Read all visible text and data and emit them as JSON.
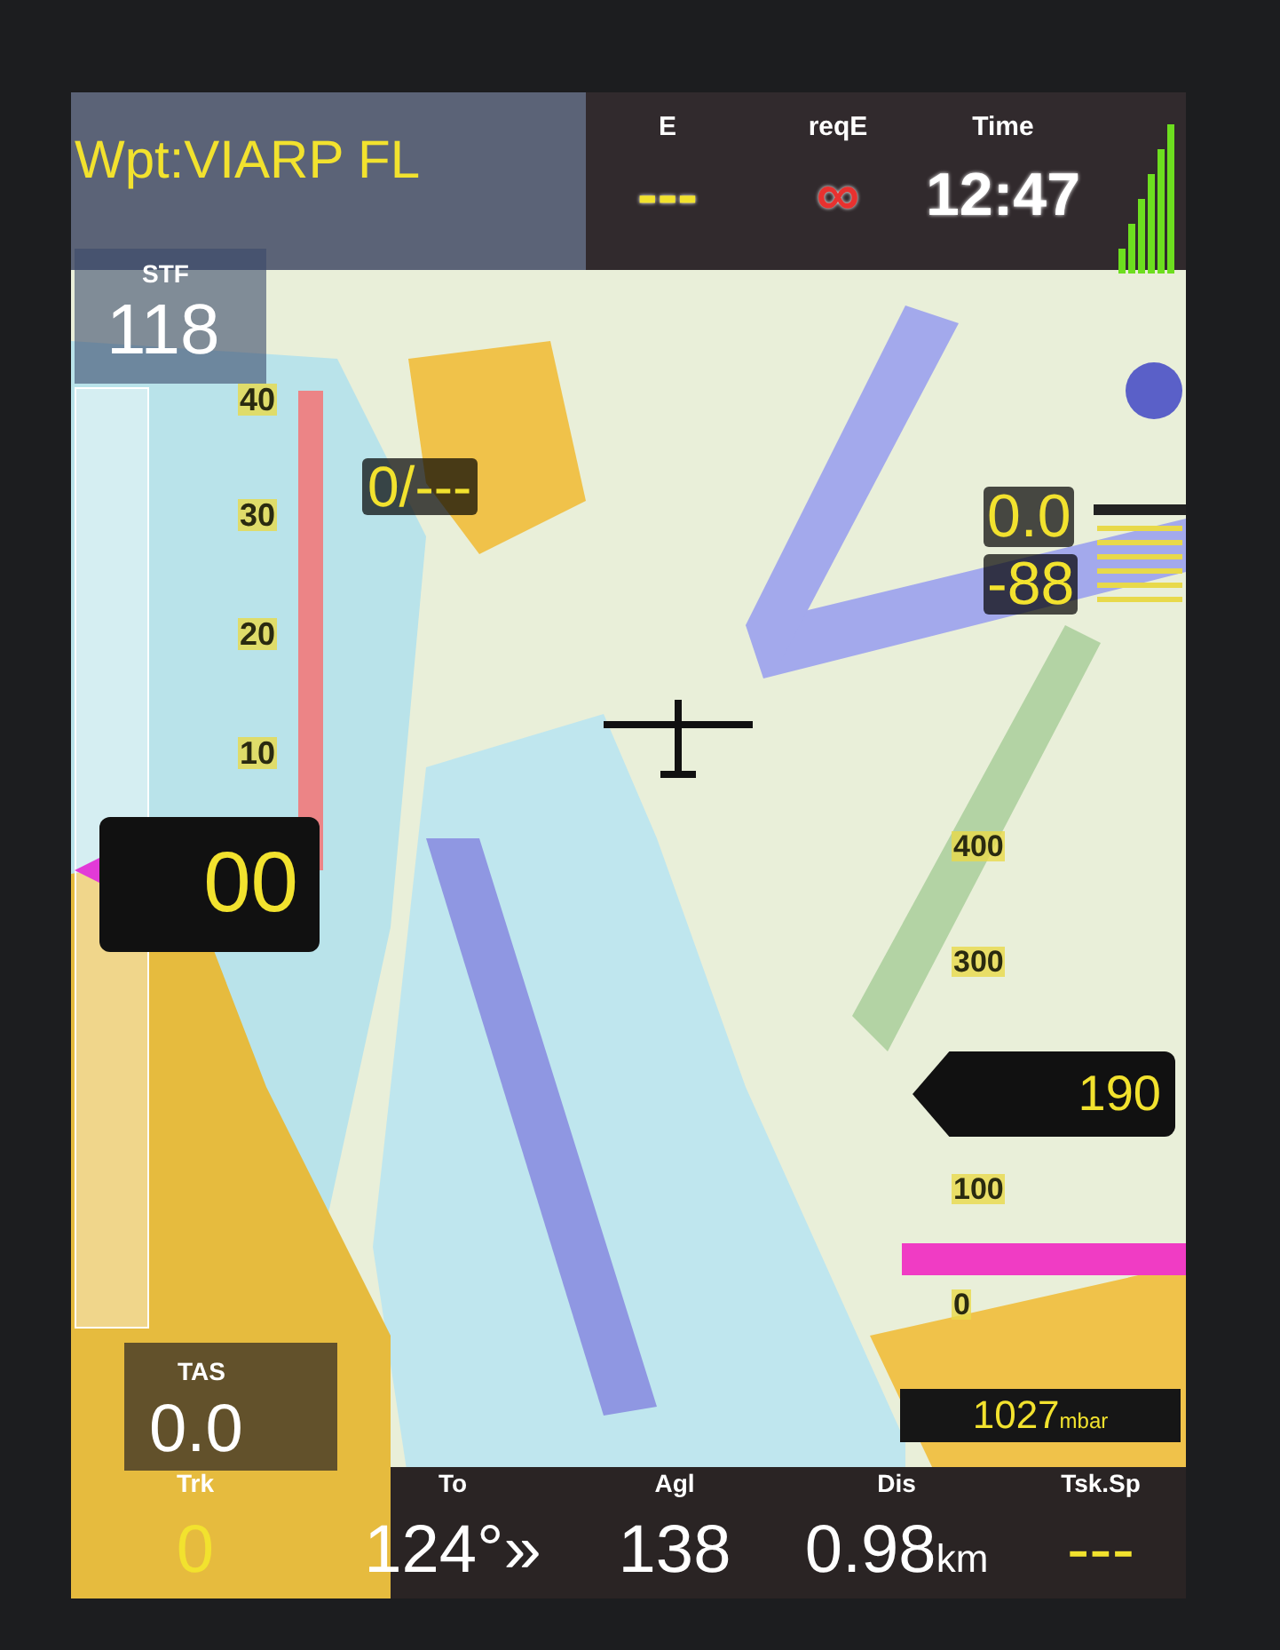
{
  "waypoint": "Wpt:VIARP FL",
  "top_fields": [
    {
      "label": "E",
      "value": "---",
      "color": "#f2e22e"
    },
    {
      "label": "reqE",
      "value": "∞",
      "color": "#e8312f"
    },
    {
      "label": "Time",
      "value": "12:47",
      "color": "#ffffff"
    }
  ],
  "stf": {
    "label": "STF",
    "value": "118"
  },
  "vario_tape": {
    "ticks": [
      "40",
      "30",
      "20",
      "10"
    ],
    "value": "00"
  },
  "glide_ratio": "0/---",
  "wind": {
    "speed": "0.0",
    "direction": "-88"
  },
  "altitude_tape": {
    "ticks": [
      "400",
      "300",
      "100",
      "0"
    ],
    "value": "190"
  },
  "qnh": {
    "value": "1027",
    "unit": "mbar"
  },
  "tas": {
    "label": "TAS",
    "value": "0.0"
  },
  "bottom_fields": [
    {
      "label": "Trk",
      "value": "0",
      "color": "#f2e22e"
    },
    {
      "label": "To",
      "value": "124°»",
      "color": "#ffffff"
    },
    {
      "label": "Agl",
      "value": "138",
      "color": "#ffffff"
    },
    {
      "label": "Dis",
      "value": "0.98",
      "unit": "km",
      "color": "#ffffff"
    },
    {
      "label": "Tsk.Sp",
      "value": "---",
      "color": "#f2e22e"
    }
  ]
}
